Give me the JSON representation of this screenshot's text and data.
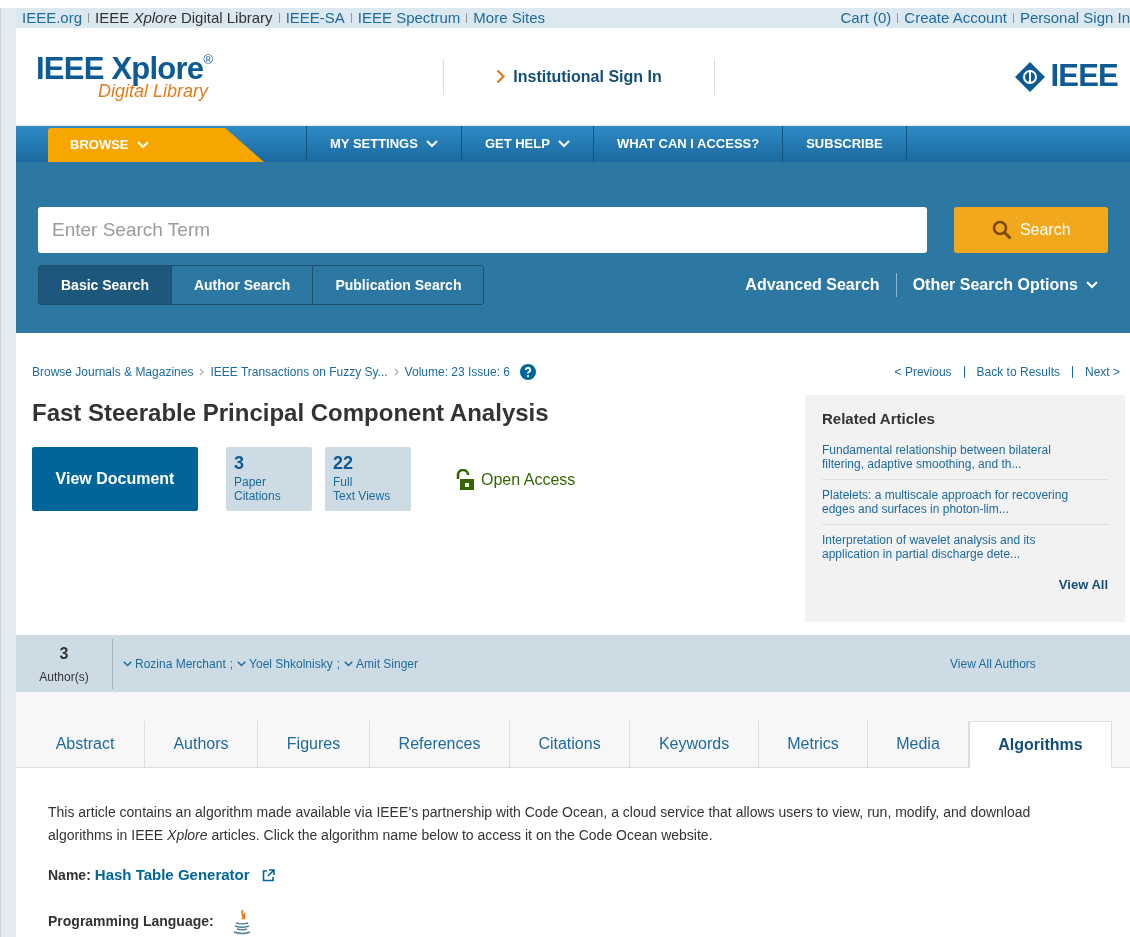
{
  "top_bar": {
    "left_links": [
      "IEEE.org",
      "IEEE *Xplore* Digital Library",
      "IEEE-SA",
      "IEEE Spectrum",
      "More Sites"
    ],
    "right_links": [
      "Cart (0)",
      "Create Account",
      "Personal Sign In"
    ]
  },
  "header": {
    "logo_main": "IEEE Xplore",
    "logo_mark": "®",
    "logo_sub": "Digital Library",
    "sign_in": "Institutional Sign In",
    "brand": "IEEE"
  },
  "nav": [
    {
      "label": "BROWSE",
      "dropdown": true,
      "selected": true
    },
    {
      "label": "MY SETTINGS",
      "dropdown": true,
      "selected": false
    },
    {
      "label": "GET HELP",
      "dropdown": true,
      "selected": false
    },
    {
      "label": "WHAT CAN I ACCESS?",
      "dropdown": false,
      "selected": false
    },
    {
      "label": "SUBSCRIBE",
      "dropdown": false,
      "selected": false
    }
  ],
  "search": {
    "placeholder": "Enter Search Term",
    "button": "Search",
    "tabs": [
      {
        "label": "Basic Search",
        "selected": true
      },
      {
        "label": "Author Search",
        "selected": false
      },
      {
        "label": "Publication Search",
        "selected": false
      }
    ],
    "advanced": "Advanced Search",
    "other_options": "Other Search Options"
  },
  "breadcrumbs": [
    "Browse Journals & Magazines",
    "IEEE Transactions on Fuzzy Sy...",
    "Volume: 23 Issue: 6"
  ],
  "pager": [
    "< Previous",
    "Back to Results",
    "Next >"
  ],
  "title": "Fast Steerable Principal Component Analysis",
  "view_document": "View Document",
  "metrics": [
    {
      "value": "3",
      "label_lines": [
        "Paper",
        "Citations"
      ]
    },
    {
      "value": "22",
      "label_lines": [
        "Full",
        "Text Views"
      ]
    }
  ],
  "open_access": "Open Access",
  "related": {
    "title": "Related Articles",
    "items": [
      "Fundamental relationship between bilateral filtering, adaptive smoothing, and th...",
      "Platelets: a multiscale approach for recovering edges and surfaces in photon-lim...",
      "Interpretation of wavelet analysis and its application in partial discharge dete..."
    ],
    "view_all": "View All"
  },
  "authors": {
    "count": "3",
    "label": "Author(s)",
    "names": [
      "Rozina Merchant",
      "Yoel Shkolnisky",
      "Amit Singer"
    ],
    "separator": ";",
    "view_all": "View All Authors"
  },
  "tabs": [
    {
      "label": "Abstract",
      "selected": false
    },
    {
      "label": "Authors",
      "selected": false
    },
    {
      "label": "Figures",
      "selected": false
    },
    {
      "label": "References",
      "selected": false
    },
    {
      "label": "Citations",
      "selected": false
    },
    {
      "label": "Keywords",
      "selected": false
    },
    {
      "label": "Metrics",
      "selected": false
    },
    {
      "label": "Media",
      "selected": false
    },
    {
      "label": "Algorithms",
      "selected": true
    }
  ],
  "algorithm": {
    "description": "This article contains an algorithm made available via IEEE’s partnership with Code Ocean, a cloud service that allows users to view, run, modify, and download algorithms in IEEE *Xplore* articles. Click the algorithm name below to access it on the Code Ocean website.",
    "name_label": "Name:",
    "name": "Hash Table Generator",
    "language_label": "Programming Language:"
  }
}
